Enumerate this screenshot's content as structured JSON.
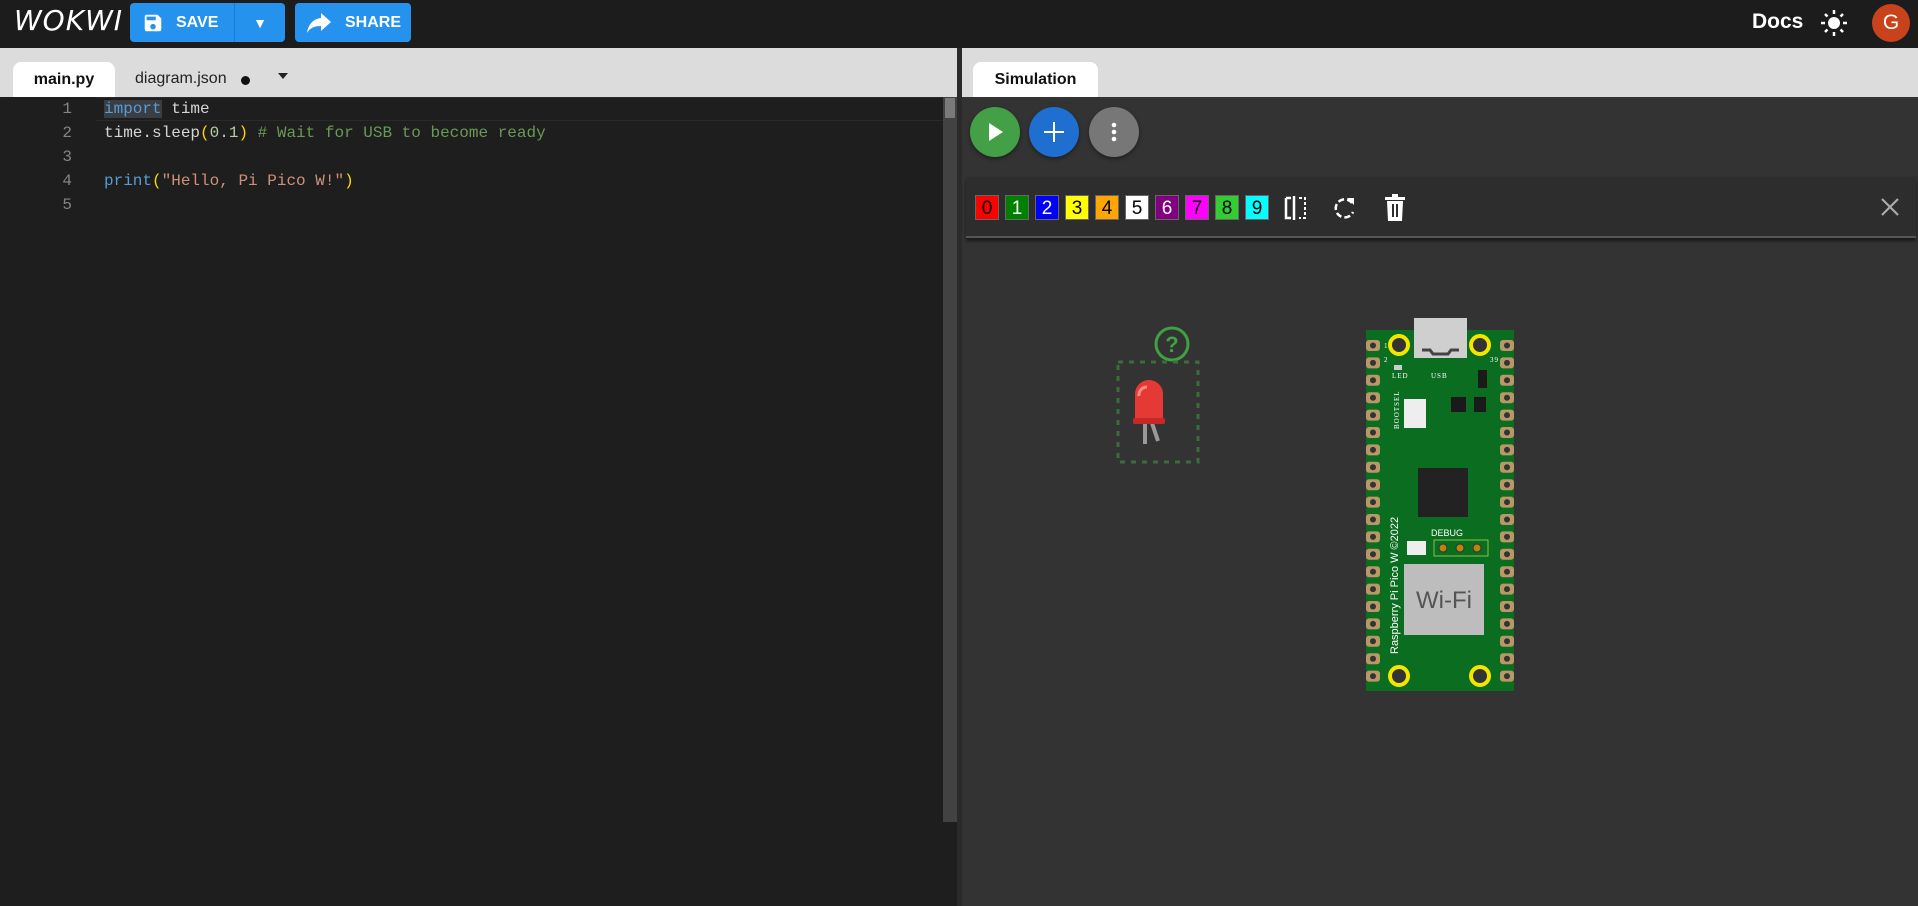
{
  "header": {
    "logo": "WOKWI",
    "save_label": "SAVE",
    "share_label": "SHARE",
    "docs_label": "Docs",
    "avatar_initial": "G"
  },
  "tabs": {
    "main": "main.py",
    "diagram": "diagram.json",
    "simulation": "Simulation"
  },
  "editor": {
    "line_numbers": [
      "1",
      "2",
      "3",
      "4",
      "5"
    ],
    "lines": {
      "l1_kw": "import",
      "l1_rest": " time",
      "l2_a": "time.sleep",
      "l2_p1": "(",
      "l2_num": "0.1",
      "l2_p2": ")",
      "l2_cm": " # Wait for USB to become ready",
      "l4_fn": "print",
      "l4_p1": "(",
      "l4_str": "\"Hello, Pi Pico W!\"",
      "l4_p2": ")"
    }
  },
  "toolbar": {
    "colors": [
      {
        "label": "0",
        "bg": "#ff0000",
        "fg": "#000"
      },
      {
        "label": "1",
        "bg": "#008000",
        "fg": "#fff"
      },
      {
        "label": "2",
        "bg": "#0000ff",
        "fg": "#fff"
      },
      {
        "label": "3",
        "bg": "#ffff00",
        "fg": "#000"
      },
      {
        "label": "4",
        "bg": "#ffa500",
        "fg": "#000"
      },
      {
        "label": "5",
        "bg": "#ffffff",
        "fg": "#000"
      },
      {
        "label": "6",
        "bg": "#800080",
        "fg": "#fff"
      },
      {
        "label": "7",
        "bg": "#ff00ff",
        "fg": "#000"
      },
      {
        "label": "8",
        "bg": "#32cd32",
        "fg": "#000"
      },
      {
        "label": "9",
        "bg": "#00ffff",
        "fg": "#000"
      }
    ]
  },
  "board": {
    "label": "Raspberry Pi Pico W ©2022",
    "led": "LED",
    "usb": "USB",
    "bootsel": "BOOTSEL",
    "debug": "DEBUG",
    "wifi": "Wi-Fi",
    "pin1": "1",
    "pin2": "2",
    "pin39": "39"
  }
}
